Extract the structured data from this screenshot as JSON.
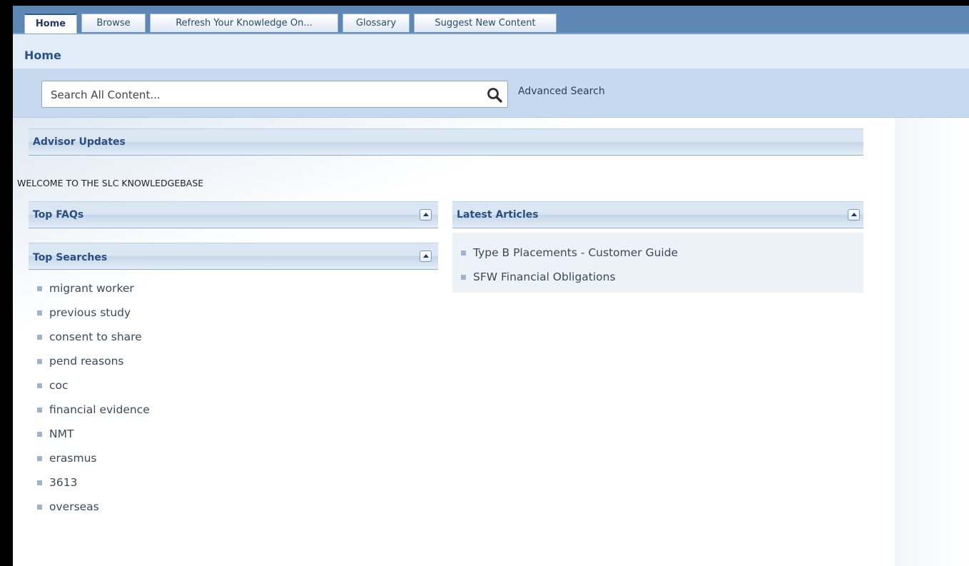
{
  "tabs": [
    {
      "label": "Home",
      "active": true
    },
    {
      "label": "Browse",
      "active": false
    },
    {
      "label": "Refresh Your Knowledge On...",
      "active": false
    },
    {
      "label": "Glossary",
      "active": false
    },
    {
      "label": "Suggest New Content",
      "active": false
    }
  ],
  "page": {
    "title": "Home"
  },
  "search": {
    "placeholder": "Search All Content...",
    "icon": "magnifier",
    "advanced_label": "Advanced Search"
  },
  "advisor_updates": {
    "title": "Advisor Updates",
    "message": "WELCOME TO THE SLC KNOWLEDGEBASE"
  },
  "top_faqs": {
    "title": "Top FAQs"
  },
  "top_searches": {
    "title": "Top Searches",
    "items": [
      "migrant worker",
      "previous study",
      "consent to share",
      "pend reasons",
      "coc",
      "financial evidence",
      "NMT",
      "erasmus",
      "3613",
      "overseas"
    ]
  },
  "latest_articles": {
    "title": "Latest Articles",
    "items": [
      "Type B Placements - Customer Guide",
      "SFW Financial Obligations"
    ]
  },
  "colors": {
    "tab_bar": "#5d88b5",
    "title_bar": "#e2ecf8",
    "search_band": "#c7d9ee",
    "heading_text": "#2b4e7e"
  }
}
